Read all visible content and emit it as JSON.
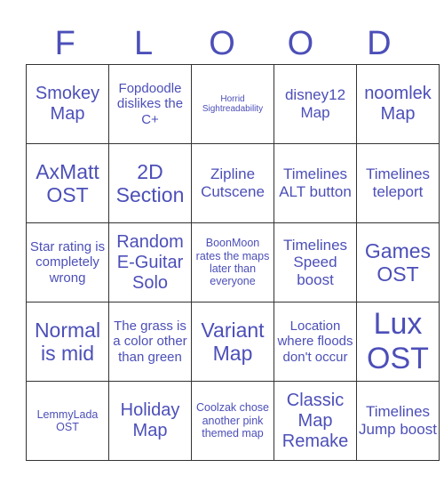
{
  "title_letters": [
    "F",
    "L",
    "O",
    "O",
    "D"
  ],
  "accent_color": "#4c4fb8",
  "cells": [
    [
      "Smokey Map",
      "Fopdoodle dislikes the C+",
      "Horrid Sightreadability",
      "disney12 Map",
      "noomlek Map"
    ],
    [
      "AxMatt OST",
      "2D Section",
      "Zipline Cutscene",
      "Timelines ALT button",
      "Timelines teleport"
    ],
    [
      "Star rating is completely wrong",
      "Random E-Guitar Solo",
      "BoonMoon rates the maps later than everyone",
      "Timelines Speed boost",
      "Games OST"
    ],
    [
      "Normal is mid",
      "The grass is a color other than green",
      "Variant Map",
      "Location where floods don't occur",
      "Lux OST"
    ],
    [
      "LemmyLada OST",
      "Holiday Map",
      "Coolzak chose another pink themed map",
      "Classic Map Remake",
      "Timelines Jump boost"
    ]
  ]
}
